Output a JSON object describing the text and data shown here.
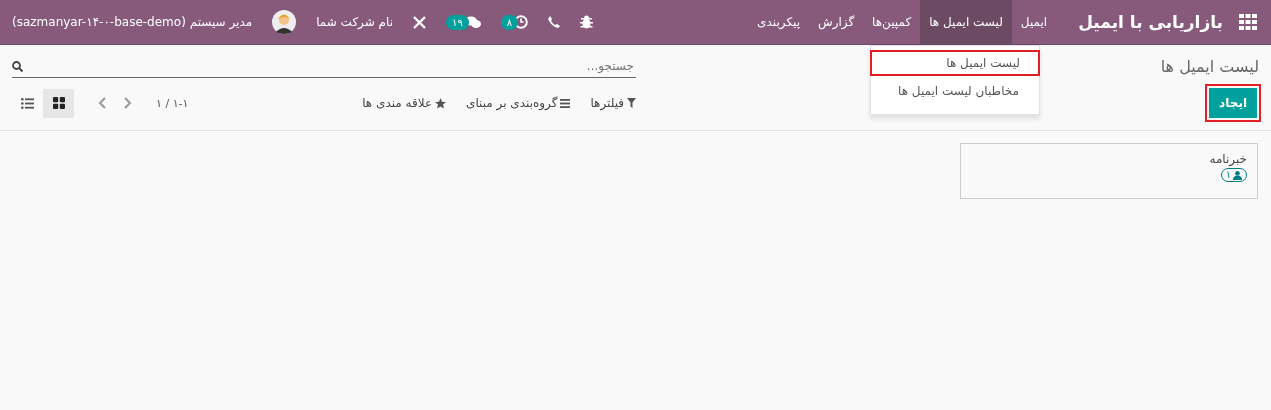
{
  "navbar": {
    "app_title": "بازاریابی با ایمیل",
    "menu": [
      {
        "label": "ایمیل",
        "selected": false
      },
      {
        "label": "لیست ایمیل ها",
        "selected": true
      },
      {
        "label": "کمپین‌ها",
        "selected": false
      },
      {
        "label": "گزارش",
        "selected": false
      },
      {
        "label": "پیکربندی",
        "selected": false
      }
    ],
    "activity_count": "۸",
    "message_count": "۱۹",
    "company": "نام شرکت شما",
    "user": "مدیر سیستم (sazmanyar-۱۴-۰-base-demo)"
  },
  "dropdown": {
    "items": [
      {
        "label": "لیست ایمیل ها",
        "highlighted": true
      },
      {
        "label": "مخاطبان لیست ایمیل ها",
        "highlighted": false
      }
    ]
  },
  "breadcrumb": "لیست ایمیل ها",
  "create_button": {
    "label": "ایجاد",
    "highlighted": true
  },
  "search": {
    "placeholder": "جستجو..."
  },
  "search_options": [
    "فیلترها",
    "گروه‌بندی بر مبنای",
    "علاقه مندی ها"
  ],
  "pager": "۱-۱ / ۱",
  "views": [
    {
      "kind": "kanban",
      "selected": true
    },
    {
      "kind": "list",
      "selected": false
    }
  ],
  "cards": [
    {
      "title": "خبرنامه",
      "count": "۱"
    }
  ]
}
